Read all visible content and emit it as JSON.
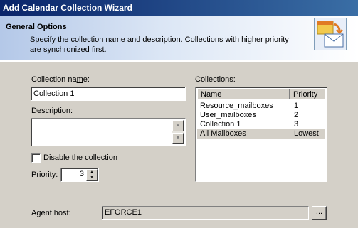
{
  "window": {
    "title": "Add Calendar Collection Wizard"
  },
  "header": {
    "title": "General Options",
    "description": "Specify the collection name and description. Collections with higher priority are synchronized first.",
    "icon": "calendar-mail-icon"
  },
  "form": {
    "name_label_before": "Collection na",
    "name_label_accel": "m",
    "name_label_after": "e:",
    "name_value": "Collection 1",
    "description_label_accel": "D",
    "description_label_after": "escription:",
    "description_value": "",
    "disable_label_before": "D",
    "disable_label_accel": "i",
    "disable_label_after": "sable the collection",
    "disable_checked": false,
    "priority_label_accel": "P",
    "priority_label_after": "riority:",
    "priority_value": "3"
  },
  "collections": {
    "label": "Collections:",
    "columns": [
      "Name",
      "Priority"
    ],
    "rows": [
      {
        "name": "Resource_mailboxes",
        "priority": "1"
      },
      {
        "name": "User_mailboxes",
        "priority": "2"
      },
      {
        "name": "Collection 1",
        "priority": "3"
      },
      {
        "name": "All Mailboxes",
        "priority": "Lowest"
      }
    ],
    "selected_index": 3
  },
  "agent": {
    "label": "Agent host:",
    "value": "EFORCE1",
    "browse_label": "..."
  },
  "colors": {
    "title_bar_start": "#0a246a",
    "title_bar_end": "#3a6ea5",
    "dialog_background": "#d4d0c8"
  }
}
